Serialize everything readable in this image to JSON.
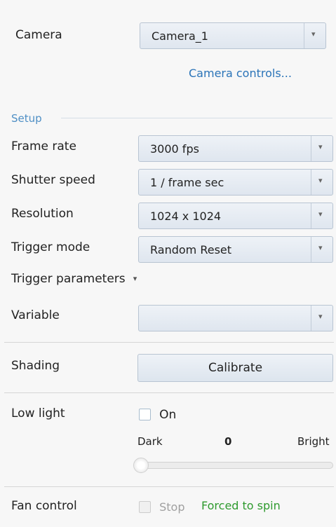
{
  "camera": {
    "label": "Camera",
    "value": "Camera_1",
    "controls_link": "Camera controls..."
  },
  "setup": {
    "title": "Setup",
    "frame_rate": {
      "label": "Frame rate",
      "value": "3000 fps"
    },
    "shutter_speed": {
      "label": "Shutter speed",
      "value": "1 / frame sec"
    },
    "resolution": {
      "label": "Resolution",
      "value": "1024 x 1024"
    },
    "trigger_mode": {
      "label": "Trigger mode",
      "value": "Random Reset"
    },
    "trigger_parameters": "Trigger parameters",
    "variable": {
      "label": "Variable",
      "value": ""
    }
  },
  "shading": {
    "label": "Shading",
    "button": "Calibrate"
  },
  "low_light": {
    "label": "Low light",
    "checkbox_label": "On",
    "checked": false,
    "slider_min_label": "Dark",
    "slider_value": "0",
    "slider_max_label": "Bright"
  },
  "fan_control": {
    "label": "Fan control",
    "checkbox_label": "Stop",
    "status": "Forced to spin"
  },
  "icons": {
    "dropdown": "chevron-down-icon",
    "expander": "caret-down-icon"
  },
  "colors": {
    "link": "#2b74b8",
    "section_title": "#4f8fc5",
    "status_ok": "#2e9a2e",
    "disabled_text": "#a0a0a0"
  }
}
